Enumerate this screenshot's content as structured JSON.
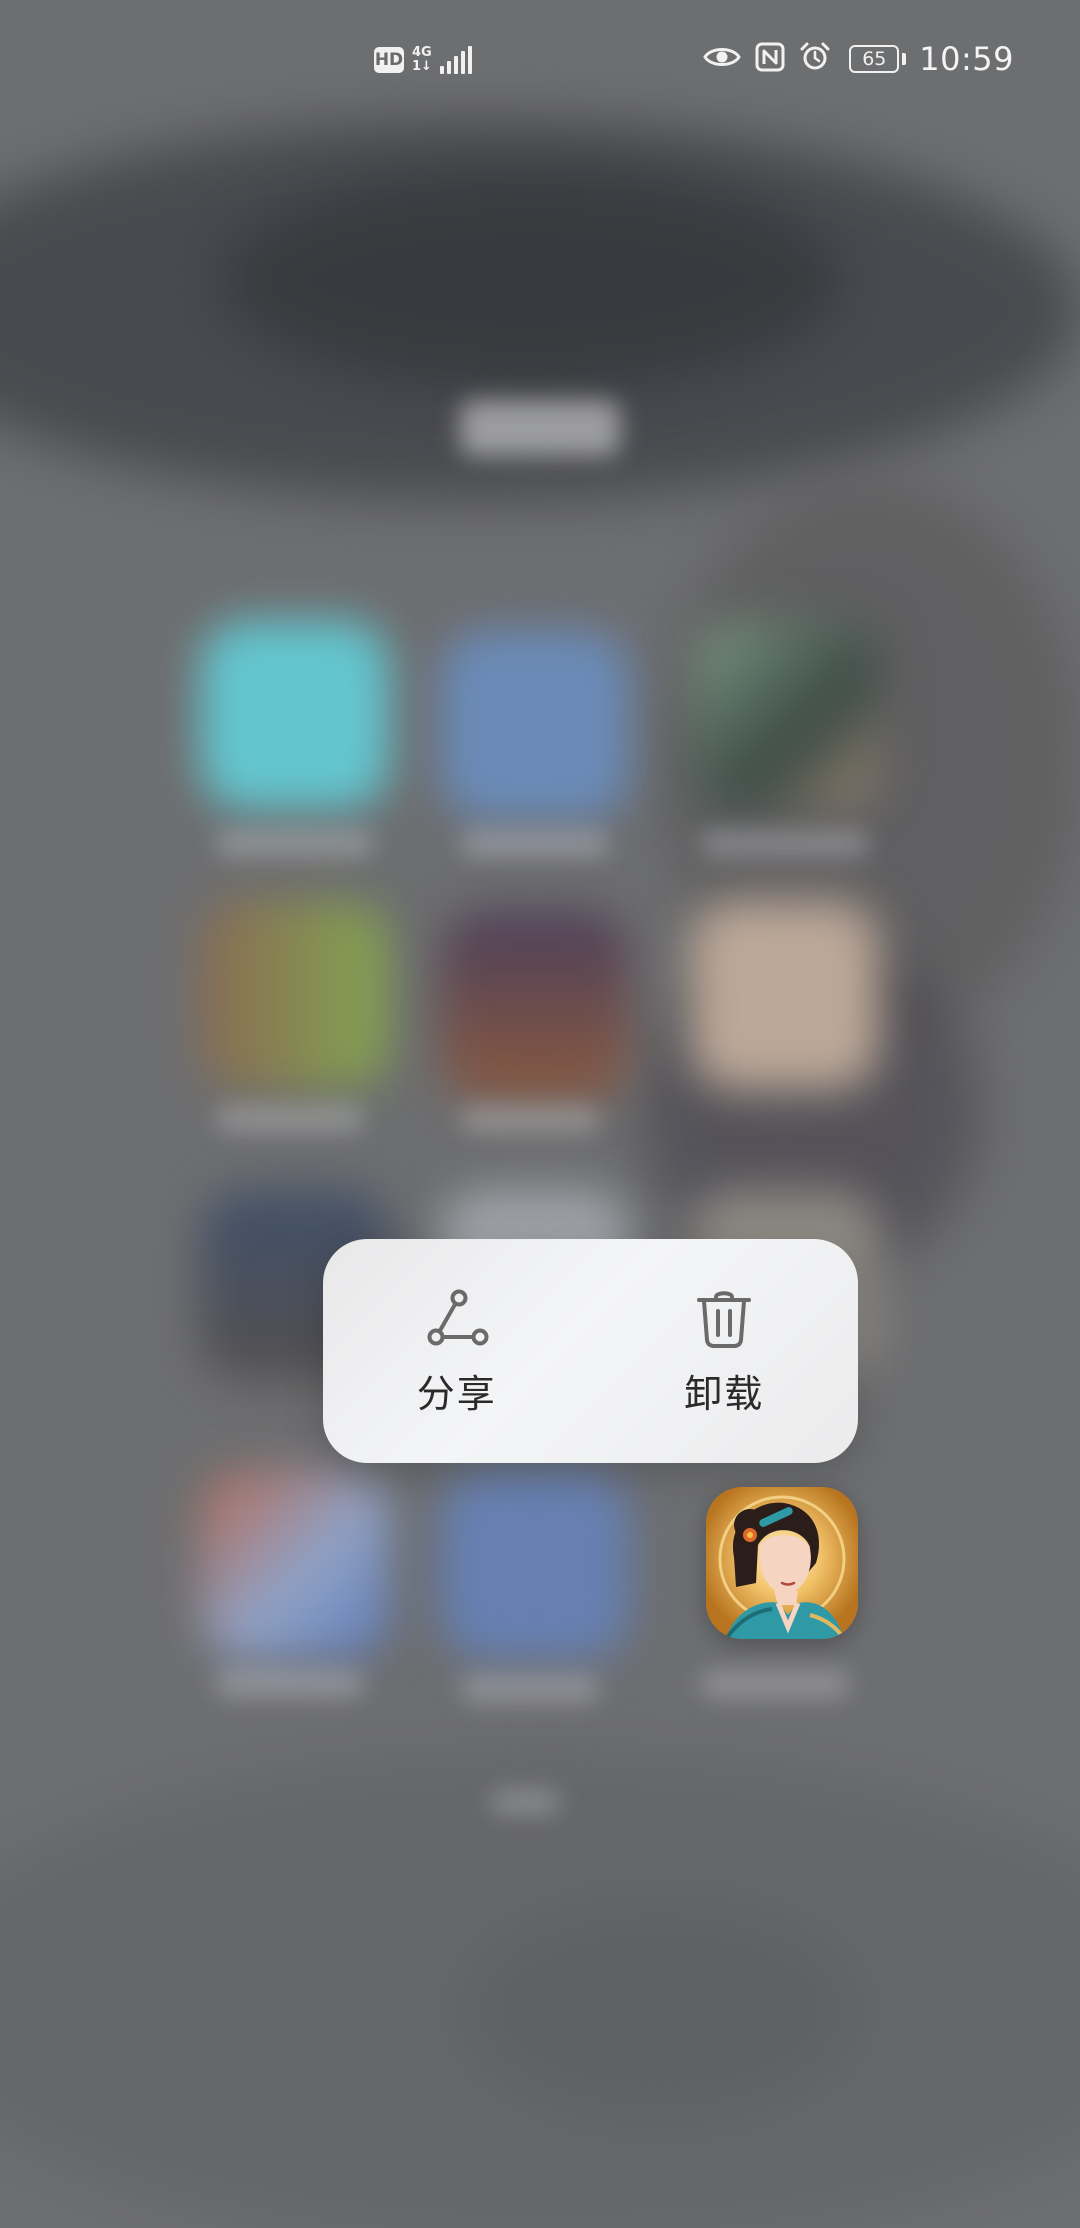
{
  "status_bar": {
    "hd_label": "HD",
    "network_type": "4G",
    "network_sub": "1↓",
    "battery_level": "65",
    "time": "10:59",
    "icons": [
      "eye-comfort-icon",
      "nfc-icon",
      "alarm-icon"
    ]
  },
  "context_menu": {
    "share_label": "分享",
    "uninstall_label": "卸载",
    "share_icon": "share-icon",
    "uninstall_icon": "trash-icon"
  },
  "app_icon": {
    "icon": "game-app-icon",
    "accent_colors": [
      "#c78a2a",
      "#2f9aa6",
      "#e06a2a"
    ]
  },
  "colors": {
    "backdrop": "#6d6e70",
    "menu_background": "#f2f3f5",
    "menu_text": "#2a2a2a",
    "status_text": "#f1f1f1"
  }
}
